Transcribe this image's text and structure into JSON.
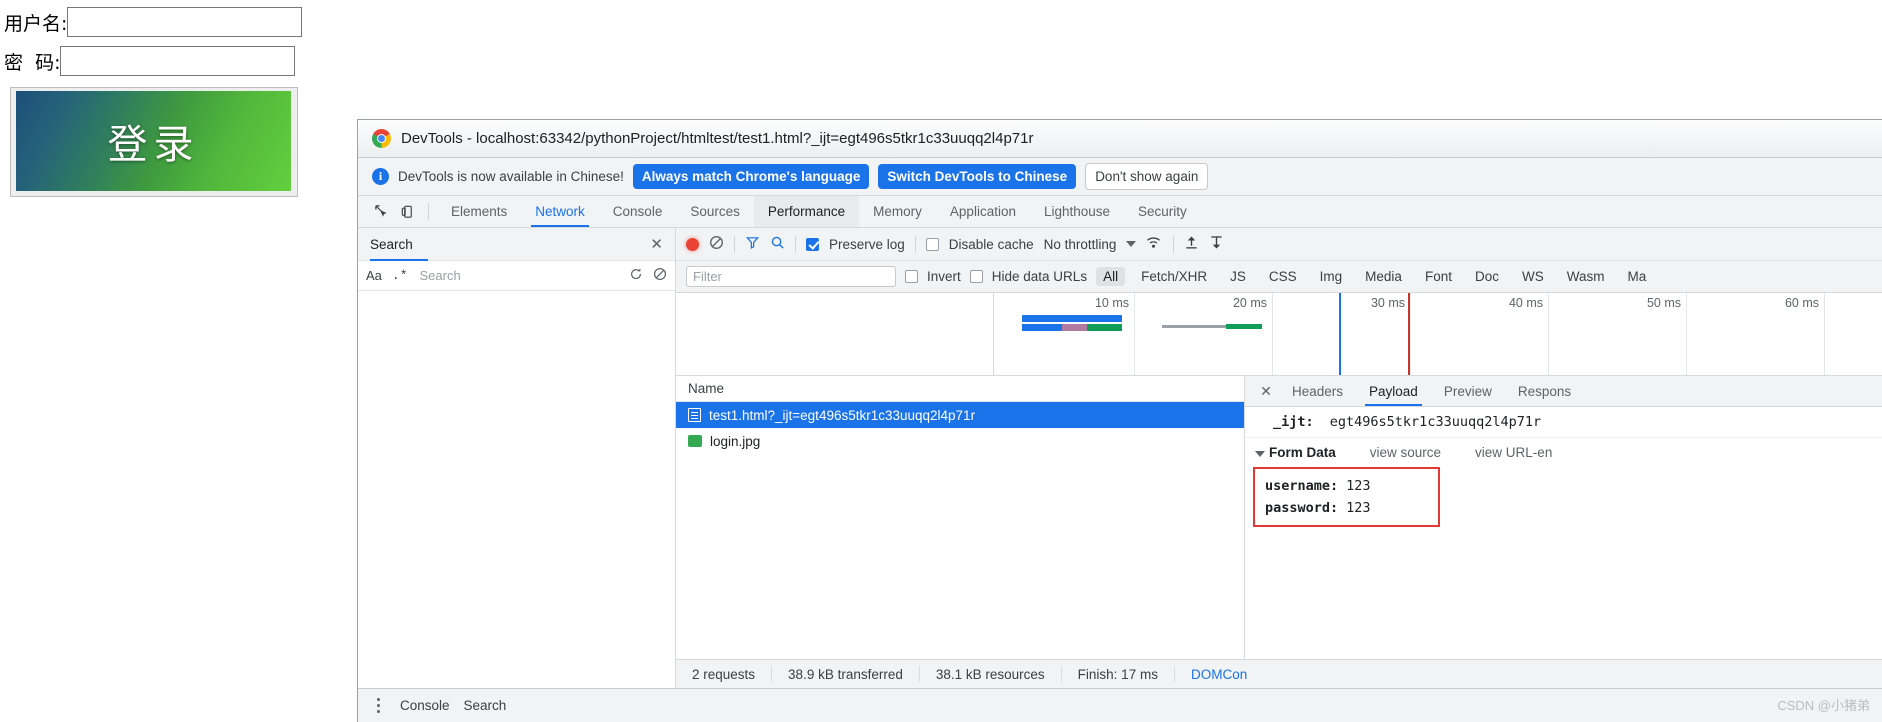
{
  "login_page": {
    "username_label": "用户名:",
    "password_label": "密  码:",
    "username_value": "",
    "password_value": "",
    "login_button_label": "登录"
  },
  "devtools": {
    "window_title": "DevTools - localhost:63342/pythonProject/htmltest/test1.html?_ijt=egt496s5tkr1c33uuqq2l4p71r",
    "banner": {
      "message": "DevTools is now available in Chinese!",
      "btn_always_match": "Always match Chrome's language",
      "btn_switch": "Switch DevTools to Chinese",
      "btn_dismiss": "Don't show again",
      "accent": "#1a73e8"
    },
    "tabs": [
      {
        "label": "Elements",
        "state": "normal"
      },
      {
        "label": "Network",
        "state": "active"
      },
      {
        "label": "Console",
        "state": "normal"
      },
      {
        "label": "Sources",
        "state": "normal"
      },
      {
        "label": "Performance",
        "state": "hover"
      },
      {
        "label": "Memory",
        "state": "normal"
      },
      {
        "label": "Application",
        "state": "normal"
      },
      {
        "label": "Lighthouse",
        "state": "normal"
      },
      {
        "label": "Security",
        "state": "normal"
      }
    ],
    "search_pane": {
      "title": "Search",
      "case_label": "Aa",
      "regex_label": ".*",
      "input_placeholder": "Search",
      "input_value": ""
    },
    "network_toolbar": {
      "preserve_log_label": "Preserve log",
      "preserve_log_checked": true,
      "disable_cache_label": "Disable cache",
      "disable_cache_checked": false,
      "throttling_label": "No throttling"
    },
    "filter_row": {
      "filter_placeholder": "Filter",
      "filter_value": "",
      "invert_label": "Invert",
      "invert_checked": false,
      "hide_data_urls_label": "Hide data URLs",
      "hide_data_urls_checked": false,
      "types": [
        "All",
        "Fetch/XHR",
        "JS",
        "CSS",
        "Img",
        "Media",
        "Font",
        "Doc",
        "WS",
        "Wasm",
        "Ma"
      ],
      "selected_type": "All"
    },
    "overview": {
      "ticks": [
        "10 ms",
        "20 ms",
        "30 ms",
        "40 ms",
        "50 ms",
        "60 ms"
      ]
    },
    "request_table": {
      "column_name": "Name",
      "rows": [
        {
          "name": "test1.html?_ijt=egt496s5tkr1c33uuqq2l4p71r",
          "icon": "document-icon",
          "selected": true
        },
        {
          "name": "login.jpg",
          "icon": "image-icon",
          "selected": false
        }
      ]
    },
    "detail_panel": {
      "tabs": [
        "Headers",
        "Payload",
        "Preview",
        "Respons"
      ],
      "active_tab": "Payload",
      "query_param_key": "_ijt:",
      "query_param_value": "egt496s5tkr1c33uuqq2l4p71r",
      "form_data_title": "Form Data",
      "view_source_label": "view source",
      "view_url_encoded_label": "view URL-en",
      "form_fields": [
        {
          "key": "username:",
          "value": "123"
        },
        {
          "key": "password:",
          "value": "123"
        }
      ],
      "highlight_color": "#e53935"
    },
    "status_bar": {
      "requests": "2 requests",
      "transferred": "38.9 kB transferred",
      "resources": "38.1 kB resources",
      "finish": "Finish: 17 ms",
      "domcontent": "DOMCon"
    },
    "drawer": {
      "console_label": "Console",
      "search_label": "Search"
    }
  },
  "watermark": "CSDN @小猪弟"
}
